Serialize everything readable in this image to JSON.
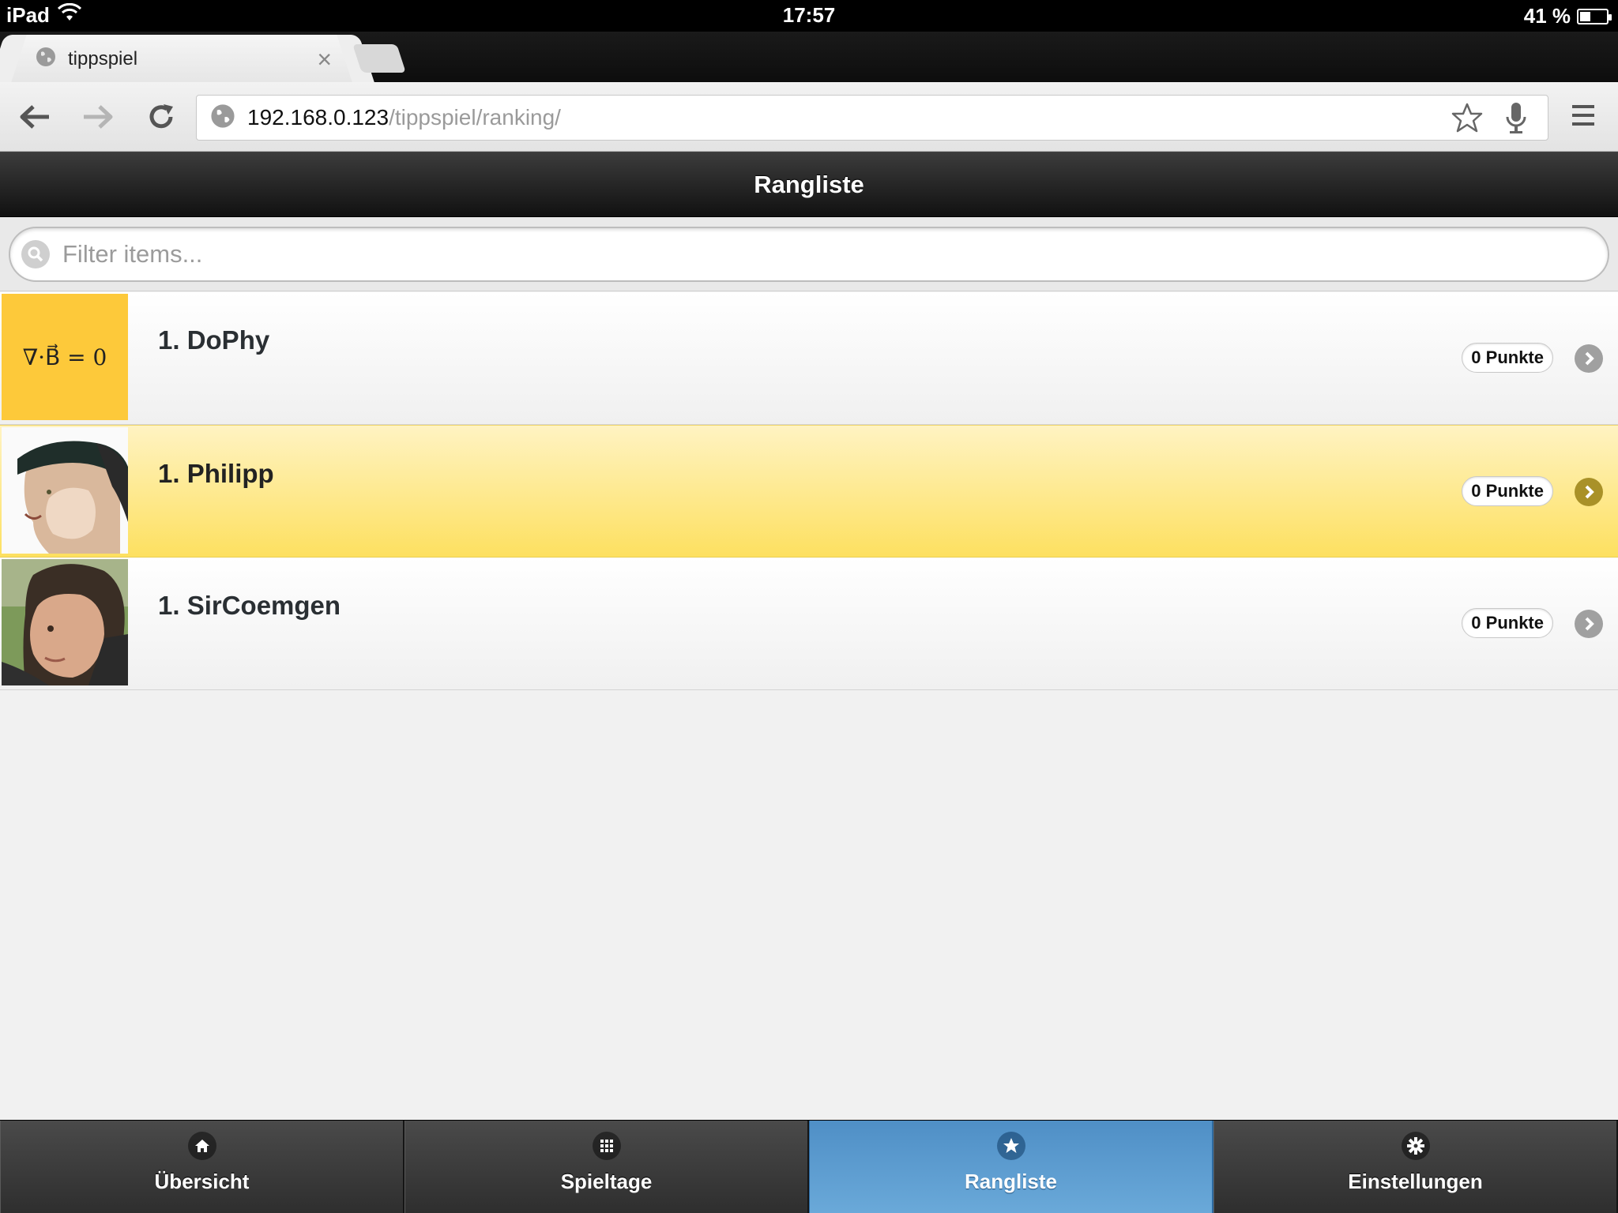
{
  "status_bar": {
    "device": "iPad",
    "time": "17:57",
    "battery": "41 %",
    "battery_level": 0.41
  },
  "browser": {
    "tab_title": "tippspiel",
    "url_host": "192.168.0.123",
    "url_path": "/tippspiel/ranking/",
    "icons": [
      "back-icon",
      "forward-icon",
      "reload-icon",
      "globe-icon",
      "star-icon",
      "microphone-icon",
      "menu-icon"
    ]
  },
  "header": {
    "title": "Rangliste"
  },
  "filter": {
    "placeholder": "Filter items..."
  },
  "ranking": [
    {
      "name": "1. DoPhy",
      "points": "0 Punkte",
      "avatar": "equation-image",
      "avatar_text": "∇·B⃗ = 0"
    },
    {
      "name": "1. Philipp",
      "points": "0 Punkte",
      "avatar": "cartoon-portrait"
    },
    {
      "name": "1. SirCoemgen",
      "points": "0 Punkte",
      "avatar": "photo-portrait"
    }
  ],
  "footer": {
    "tabs": [
      {
        "label": "Übersicht",
        "icon": "home-icon"
      },
      {
        "label": "Spieltage",
        "icon": "grid-icon"
      },
      {
        "label": "Rangliste",
        "icon": "star-icon",
        "active": true
      },
      {
        "label": "Einstellungen",
        "icon": "gear-icon"
      }
    ]
  },
  "colors": {
    "active_row": "#fde060",
    "active_tab": "#5b9bd0",
    "header_bg": "#1a1a1a"
  }
}
